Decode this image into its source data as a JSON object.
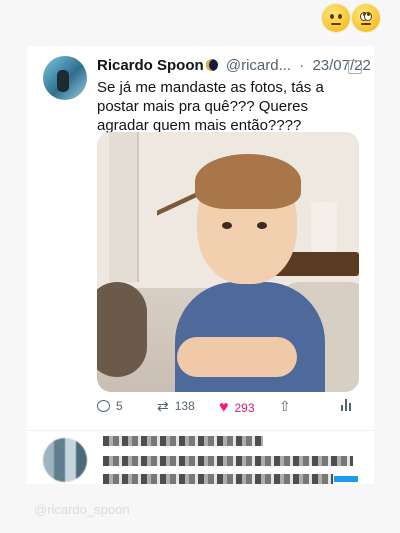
{
  "tweet": {
    "author_name": "Ricardo Spoon",
    "handle": "@ricard...",
    "date_sep": "·",
    "date": "23/07/22",
    "text": "Se já me mandaste as fotos, tás a postar mais pra quê??? Queres agradar quem mais então????",
    "replies": "5",
    "retweets": "138",
    "likes": "293"
  },
  "colors": {
    "like_active": "#f91880",
    "accent_blue": "#1d9bf0"
  },
  "icons": {
    "reply": "reply-icon",
    "retweet": "retweet-icon",
    "like": "heart-icon",
    "share": "share-icon",
    "analytics": "analytics-icon"
  },
  "watermark": "@ricardo_spoon"
}
